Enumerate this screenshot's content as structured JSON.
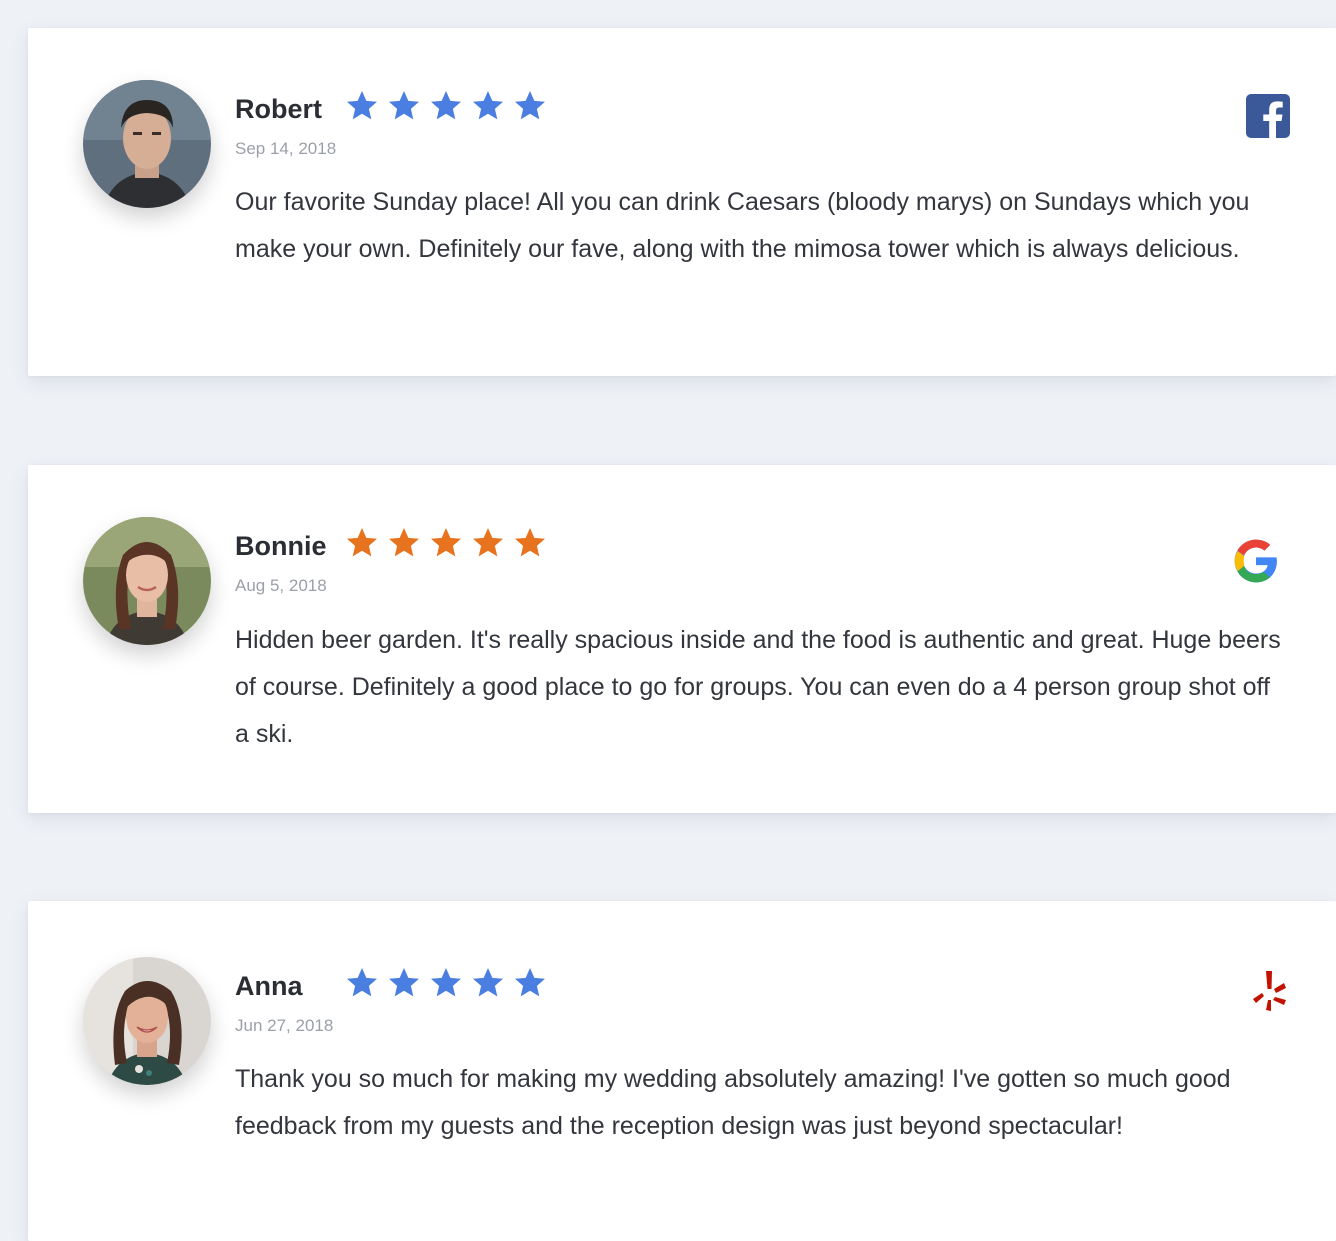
{
  "reviews": [
    {
      "name": "Robert",
      "date": "Sep 14, 2018",
      "rating": 5,
      "star_color": "#4a7ee0",
      "text": "Our favorite Sunday place! All you can drink Caesars (bloody marys) on Sundays which you make your own. Definitely our fave, along with the mimosa tower which is always delicious.",
      "source_icon": "facebook-icon",
      "source_color": "#3b5998"
    },
    {
      "name": "Bonnie",
      "date": "Aug 5, 2018",
      "rating": 5,
      "star_color": "#e8731f",
      "text": "Hidden beer garden. It's really spacious inside and the food is authentic and great. Huge beers of course. Definitely a good place to go for groups. You can even do a 4 person group shot off a ski.",
      "source_icon": "google-icon",
      "source_color": "#4285f4"
    },
    {
      "name": "Anna",
      "date": "Jun 27, 2018",
      "rating": 5,
      "star_color": "#4a7ee0",
      "text": "Thank you so much for making my wedding absolutely amazing! I've gotten so much good feedback from my guests and the reception design was just beyond spectacular!",
      "source_icon": "yelp-icon",
      "source_color": "#c41200"
    }
  ]
}
